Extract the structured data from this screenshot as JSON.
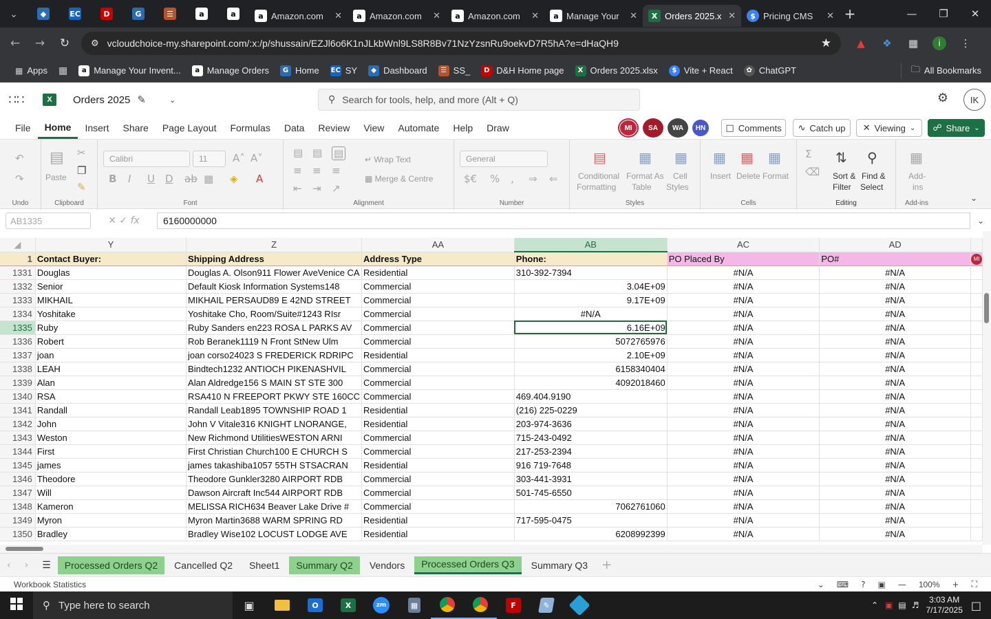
{
  "browser": {
    "tabs": [
      {
        "title": "Amazon.com",
        "color": "#fff"
      },
      {
        "title": "Amazon.com",
        "color": "#fff"
      },
      {
        "title": "Amazon.com",
        "color": "#fff"
      },
      {
        "title": "Manage Your",
        "color": "#fff"
      },
      {
        "title": "Orders 2025.x",
        "color": "#1d7044"
      },
      {
        "title": "Pricing CMS",
        "color": "#3b82f6"
      }
    ],
    "url": "vcloudchoice-my.sharepoint.com/:x:/p/shussain/EZJl6o6K1nJLkbWnl9LS8R8Bv71NzYzsnRu9oekvD7R5hA?e=dHaQH9",
    "bookmarks": [
      "Apps",
      "Manage Your Invent...",
      "Manage Orders",
      "Home",
      "SY",
      "Dashboard",
      "SS_",
      "D&H Home page",
      "Orders 2025.xlsx",
      "Vite + React",
      "ChatGPT"
    ],
    "all_bookmarks": "All Bookmarks"
  },
  "excel": {
    "doc_title": "Orders 2025",
    "search_placeholder": "Search for tools, help, and more (Alt + Q)",
    "avatar": "IK",
    "menu": [
      "File",
      "Home",
      "Insert",
      "Share",
      "Page Layout",
      "Formulas",
      "Data",
      "Review",
      "View",
      "Automate",
      "Help",
      "Draw"
    ],
    "presence": [
      {
        "initials": "MI",
        "color": "#c0263b"
      },
      {
        "initials": "SA",
        "color": "#a31a2a"
      },
      {
        "initials": "WA",
        "color": "#444444"
      },
      {
        "initials": "HN",
        "color": "#4a57c8"
      }
    ],
    "comments": "Comments",
    "catch_up": "Catch up",
    "viewing": "Viewing",
    "share": "Share"
  },
  "ribbon": {
    "undo_label": "Undo",
    "paste": "Paste",
    "clipboard": "Clipboard",
    "font_name": "Calibri",
    "font_size": "11",
    "font": "Font",
    "wrap_text": "Wrap Text",
    "merge_centre": "Merge & Centre",
    "alignment": "Alignment",
    "number_format": "General",
    "number": "Number",
    "conditional": "Conditional",
    "formatting": "Formatting",
    "format_as": "Format As",
    "table": "Table",
    "cell": "Cell",
    "styles_l": "Styles",
    "styles": "Styles",
    "insert": "Insert",
    "delete": "Delete",
    "format": "Format",
    "cells": "Cells",
    "sort": "Sort &",
    "filter": "Filter",
    "find": "Find &",
    "select": "Select",
    "editing": "Editing",
    "addins": "Add-",
    "addins2": "ins",
    "addins_group": "Add-ins"
  },
  "formula": {
    "name_box": "AB1335",
    "value": "6160000000"
  },
  "sheet": {
    "columns": [
      "Y",
      "Z",
      "AA",
      "AB",
      "AC",
      "AD"
    ],
    "header_row": {
      "num": "1",
      "cells": [
        "Contact Buyer:",
        "Shipping Address",
        "Address Type",
        "Phone:",
        "PO Placed By",
        "PO#"
      ]
    },
    "rows": [
      {
        "num": "1331",
        "y": "Douglas",
        "z": "Douglas A. Olson911 Flower AveVenice CA",
        "aa": "Residential",
        "ab": "310-392-7394",
        "ab_align": "l",
        "ac": "#N/A",
        "ad": "#N/A"
      },
      {
        "num": "1332",
        "y": "Senior",
        "z": "Default Kiosk Information Systems148",
        "aa": "Commercial",
        "ab": "3.04E+09",
        "ab_align": "r",
        "ac": "#N/A",
        "ad": "#N/A"
      },
      {
        "num": "1333",
        "y": "MIKHAIL",
        "z": "MIKHAIL PERSAUD89 E 42ND STREET",
        "aa": "Commercial",
        "ab": "9.17E+09",
        "ab_align": "r",
        "ac": "#N/A",
        "ad": "#N/A"
      },
      {
        "num": "1334",
        "y": "Yoshitake",
        "z": "Yoshitake Cho, Room/Suite#1243 RIsr",
        "aa": "Commercial",
        "ab": "#N/A",
        "ab_align": "c",
        "ac": "#N/A",
        "ad": "#N/A"
      },
      {
        "num": "1335",
        "y": "Ruby",
        "z": "Ruby Sanders en223 ROSA L PARKS AV",
        "aa": "Commercial",
        "ab": "6.16E+09",
        "ab_align": "r",
        "ac": "#N/A",
        "ad": "#N/A"
      },
      {
        "num": "1336",
        "y": "Robert",
        "z": "Rob Beranek1119 N Front StNew Ulm",
        "aa": "Commercial",
        "ab": "5072765976",
        "ab_align": "r",
        "ac": "#N/A",
        "ad": "#N/A"
      },
      {
        "num": "1337",
        "y": "joan",
        "z": "joan corso24023 S FREDERICK RDRIPC",
        "aa": "Residential",
        "ab": "2.10E+09",
        "ab_align": "r",
        "ac": "#N/A",
        "ad": "#N/A"
      },
      {
        "num": "1338",
        "y": "LEAH",
        "z": "Bindtech1232 ANTIOCH PIKENASHVIL",
        "aa": "Commercial",
        "ab": "6158340404",
        "ab_align": "r",
        "ac": "#N/A",
        "ad": "#N/A"
      },
      {
        "num": "1339",
        "y": "Alan",
        "z": "Alan Aldredge156 S MAIN ST STE 300",
        "aa": "Commercial",
        "ab": "4092018460",
        "ab_align": "r",
        "ac": "#N/A",
        "ad": "#N/A"
      },
      {
        "num": "1340",
        "y": "RSA",
        "z": "RSA410 N FREEPORT PKWY STE 160CC",
        "aa": "Commercial",
        "ab": "469.404.9190",
        "ab_align": "l",
        "ac": "#N/A",
        "ad": "#N/A"
      },
      {
        "num": "1341",
        "y": "Randall",
        "z": "Randall Leab1895 TOWNSHIP ROAD 1",
        "aa": "Residential",
        "ab": "(216) 225-0229",
        "ab_align": "l",
        "ac": "#N/A",
        "ad": "#N/A"
      },
      {
        "num": "1342",
        "y": "John",
        "z": "John V Vitale316 KNIGHT LNORANGE,",
        "aa": "Residential",
        "ab": "203-974-3636",
        "ab_align": "l",
        "ac": "#N/A",
        "ad": "#N/A"
      },
      {
        "num": "1343",
        "y": "Weston",
        "z": "New Richmond UtilitiesWESTON ARNI",
        "aa": "Commercial",
        "ab": "715-243-0492",
        "ab_align": "l",
        "ac": "#N/A",
        "ad": "#N/A"
      },
      {
        "num": "1344",
        "y": "First",
        "z": "First Christian Church100 E CHURCH S",
        "aa": "Commercial",
        "ab": "217-253-2394",
        "ab_align": "l",
        "ac": "#N/A",
        "ad": "#N/A"
      },
      {
        "num": "1345",
        "y": "james",
        "z": "james takashiba1057 55TH STSACRAN",
        "aa": "Residential",
        "ab": "916 719-7648",
        "ab_align": "l",
        "ac": "#N/A",
        "ad": "#N/A"
      },
      {
        "num": "1346",
        "y": "Theodore",
        "z": "Theodore Gunkler3280 AIRPORT RDB",
        "aa": "Commercial",
        "ab": "303-441-3931",
        "ab_align": "l",
        "ac": "#N/A",
        "ad": "#N/A"
      },
      {
        "num": "1347",
        "y": "Will",
        "z": "Dawson Aircraft Inc544 AIRPORT RDB",
        "aa": "Commercial",
        "ab": "501-745-6550",
        "ab_align": "l",
        "ac": "#N/A",
        "ad": "#N/A"
      },
      {
        "num": "1348",
        "y": "Kameron",
        "z": "MELISSA RICH634 Beaver Lake Drive #",
        "aa": "Commercial",
        "ab": "7062761060",
        "ab_align": "r",
        "ac": "#N/A",
        "ad": "#N/A"
      },
      {
        "num": "1349",
        "y": "Myron",
        "z": "Myron Martin3688 WARM SPRING RD",
        "aa": "Residential",
        "ab": "717-595-0475",
        "ab_align": "l",
        "ac": "#N/A",
        "ad": "#N/A"
      },
      {
        "num": "1350",
        "y": "Bradley",
        "z": "Bradley Wise102 LOCUST LODGE AVE",
        "aa": "Residential",
        "ab": "6208992399",
        "ab_align": "r",
        "ac": "#N/A",
        "ad": "#N/A"
      }
    ]
  },
  "sheet_tabs": [
    {
      "name": "Processed Orders Q2",
      "green": true
    },
    {
      "name": "Cancelled Q2",
      "green": false
    },
    {
      "name": "Sheet1",
      "green": false
    },
    {
      "name": "Summary Q2",
      "green": true
    },
    {
      "name": "Vendors",
      "green": false
    },
    {
      "name": "Processed Orders Q3",
      "green": true,
      "active": true
    },
    {
      "name": "Summary Q3",
      "green": false
    }
  ],
  "status": {
    "left": "Workbook Statistics",
    "zoom": "100%"
  },
  "taskbar": {
    "search": "Type here to search",
    "time": "3:03 AM",
    "date": "7/17/2025"
  }
}
